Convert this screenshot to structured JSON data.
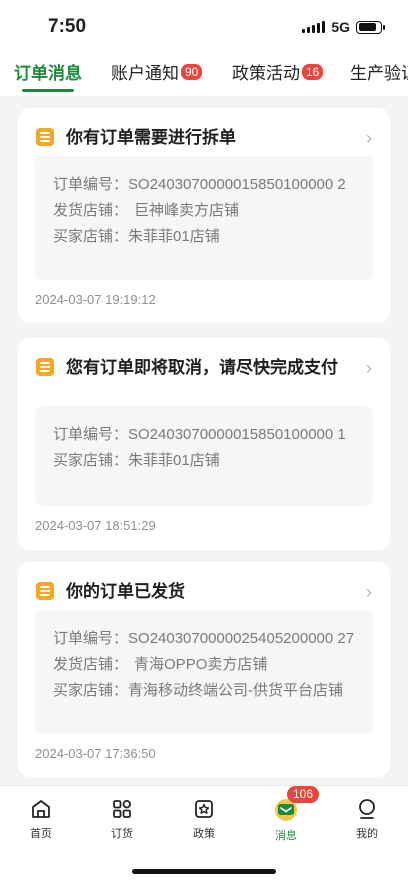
{
  "status": {
    "time": "7:50",
    "network": "5G"
  },
  "tabs": [
    {
      "label": "订单消息",
      "badge": ""
    },
    {
      "label": "账户通知",
      "badge": "90"
    },
    {
      "label": "政策活动",
      "badge": "16"
    },
    {
      "label": "生产验证",
      "badge": ""
    }
  ],
  "cards": [
    {
      "title": "你有订单需要进行拆单",
      "order_label": "订单编号：",
      "order_no": "SO2403070000015850100000 2",
      "ship_label": "发货店铺：",
      "ship_store": "巨神峰卖方店铺",
      "buyer_label": "买家店铺：",
      "buyer_store": "朱菲菲01店铺",
      "time": "2024-03-07 19:19:12"
    },
    {
      "title": "您有订单即将取消，请尽快完成支付",
      "order_label": "订单编号：",
      "order_no": "SO2403070000015850100000 1",
      "buyer_label": "买家店铺：",
      "buyer_store": "朱菲菲01店铺",
      "time": "2024-03-07 18:51:29"
    },
    {
      "title": "你的订单已发货",
      "order_label": "订单编号：",
      "order_no": "SO2403070000025405200000 27",
      "ship_label": "发货店铺：",
      "ship_store": "青海OPPO卖方店铺",
      "buyer_label": "买家店铺：",
      "buyer_store": "青海移动终端公司-供货平台店铺",
      "time": "2024-03-07 17:36:50"
    }
  ],
  "nav": [
    {
      "label": "首页"
    },
    {
      "label": "订货"
    },
    {
      "label": "政策"
    },
    {
      "label": "消息",
      "badge": "106"
    },
    {
      "label": "我的"
    }
  ],
  "colors": {
    "accent": "#1f8a3b",
    "badge": "#e8453c",
    "doc_icon": "#f5a623"
  }
}
